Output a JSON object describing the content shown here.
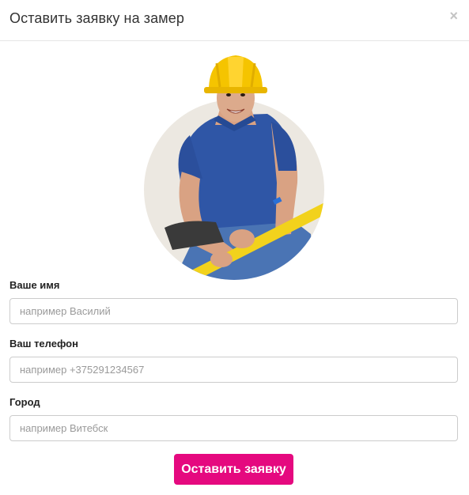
{
  "modal": {
    "title": "Оставить заявку на замер",
    "close_label": "×"
  },
  "illustration": {
    "description_icon": "worker-photo"
  },
  "form": {
    "fields": [
      {
        "label": "Ваше имя",
        "placeholder": "например Василий",
        "value": ""
      },
      {
        "label": "Ваш телефон",
        "placeholder": "например +375291234567",
        "value": ""
      },
      {
        "label": "Город",
        "placeholder": "например Витебск",
        "value": ""
      }
    ],
    "submit_label": "Оставить заявку"
  },
  "colors": {
    "accent": "#e5097f",
    "helmet": "#f5c400",
    "shirt": "#2f56a6",
    "jeans": "#4a74b4",
    "level_tool": "#f2d21c",
    "backdrop": "#ece8e1"
  }
}
